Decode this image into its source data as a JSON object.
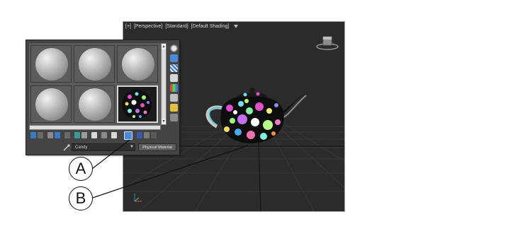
{
  "viewport": {
    "labels": [
      "[+]",
      "[Perspective]",
      "[Standard]",
      "[Default Shading]"
    ],
    "background_color": "#2b2b2b"
  },
  "material_editor": {
    "material_name": "Candy",
    "dropdown_glyph": "▼",
    "material_type": "Physical Material",
    "slot_count": 6,
    "active_slot": 6,
    "scroll_up_glyph": "▲",
    "scroll_down_glyph": "▼"
  },
  "callouts": {
    "a": "A",
    "b": "B"
  }
}
